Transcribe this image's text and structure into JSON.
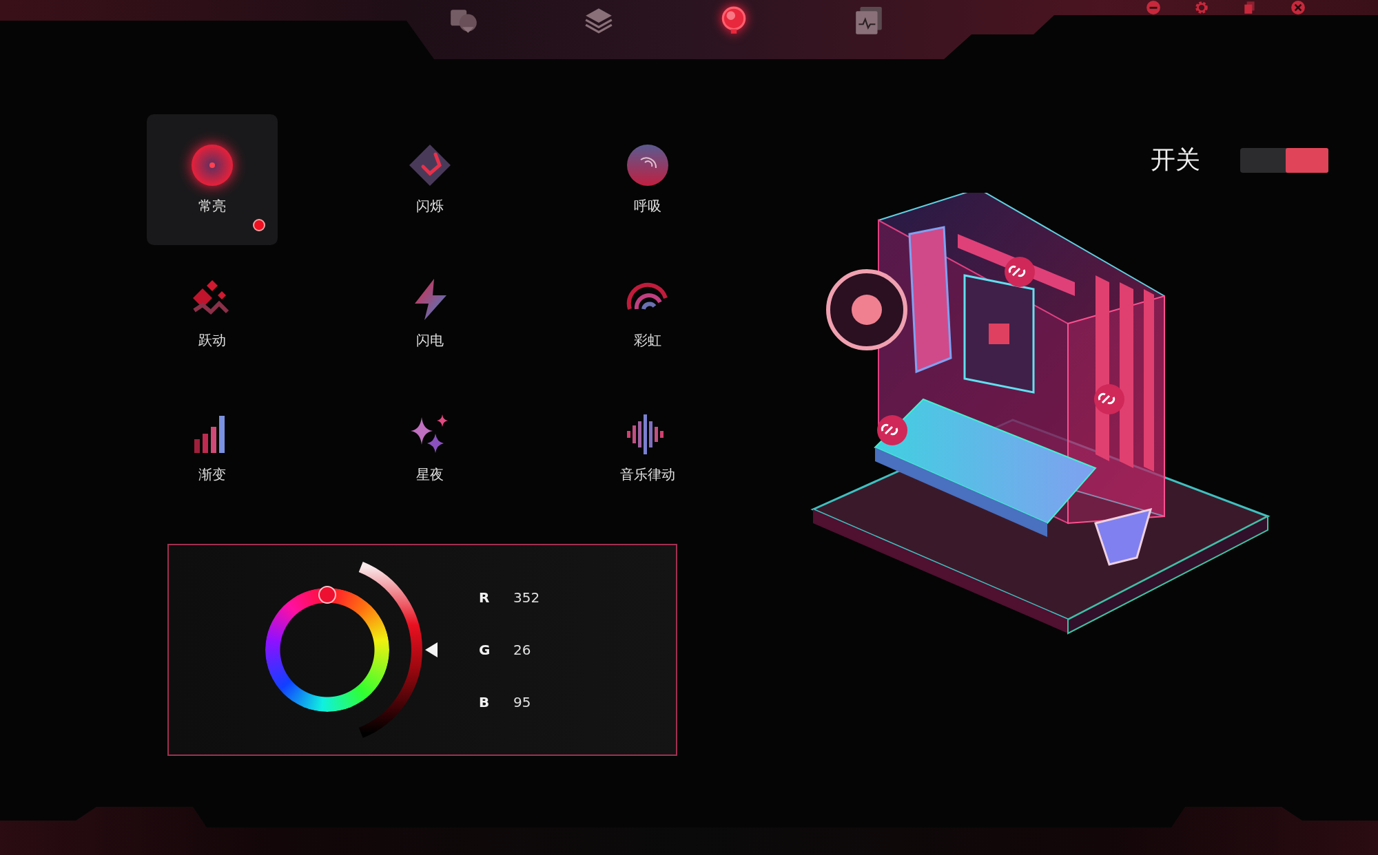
{
  "nav_tabs": [
    {
      "kind": "devices",
      "selected": false
    },
    {
      "kind": "layers",
      "selected": false
    },
    {
      "kind": "lighting",
      "selected": true
    },
    {
      "kind": "monitor",
      "selected": false
    }
  ],
  "window_controls": [
    {
      "kind": "minimize"
    },
    {
      "kind": "settings"
    },
    {
      "kind": "restore"
    },
    {
      "kind": "close"
    }
  ],
  "effects": [
    {
      "label": "常亮",
      "kind": "steady",
      "selected": true
    },
    {
      "label": "闪烁",
      "kind": "blink",
      "selected": false
    },
    {
      "label": "呼吸",
      "kind": "breathe",
      "selected": false
    },
    {
      "label": "跃动",
      "kind": "jump",
      "selected": false
    },
    {
      "label": "闪电",
      "kind": "lightning",
      "selected": false
    },
    {
      "label": "彩虹",
      "kind": "rainbow",
      "selected": false
    },
    {
      "label": "渐变",
      "kind": "gradient",
      "selected": false
    },
    {
      "label": "星夜",
      "kind": "starry",
      "selected": false
    },
    {
      "label": "音乐律动",
      "kind": "music",
      "selected": false
    }
  ],
  "color_picker": {
    "channels": [
      {
        "name": "R",
        "value": "352"
      },
      {
        "name": "G",
        "value": "26"
      },
      {
        "name": "B",
        "value": "95"
      }
    ]
  },
  "power_switch": {
    "label": "开关",
    "on": true
  }
}
